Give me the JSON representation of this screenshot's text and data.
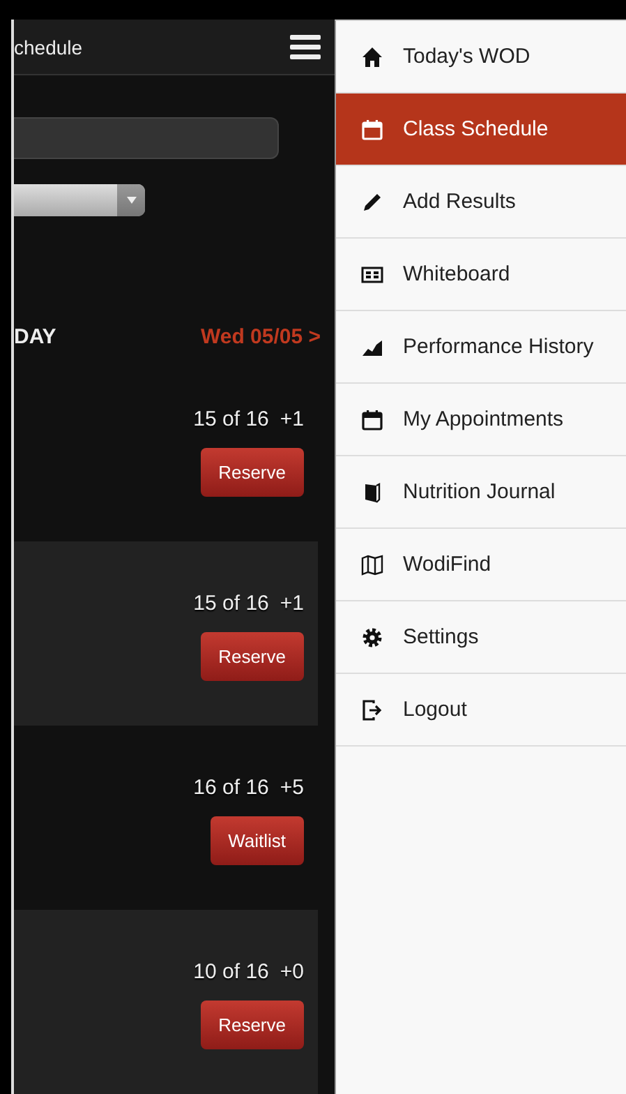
{
  "header": {
    "title": "chedule"
  },
  "day_header": {
    "label": "DAY",
    "next_date": "Wed 05/05 >"
  },
  "classes": [
    {
      "count": "15 of 16",
      "extra": "+1",
      "button": "Reserve"
    },
    {
      "count": "15 of 16",
      "extra": "+1",
      "button": "Reserve"
    },
    {
      "count": "16 of 16",
      "extra": "+5",
      "button": "Waitlist"
    },
    {
      "count": "10 of 16",
      "extra": "+0",
      "button": "Reserve"
    }
  ],
  "menu": [
    {
      "label": "Today's WOD",
      "selected": false
    },
    {
      "label": "Class Schedule",
      "selected": true
    },
    {
      "label": "Add Results",
      "selected": false
    },
    {
      "label": "Whiteboard",
      "selected": false
    },
    {
      "label": "Performance History",
      "selected": false
    },
    {
      "label": "My Appointments",
      "selected": false
    },
    {
      "label": "Nutrition Journal",
      "selected": false
    },
    {
      "label": "WodiFind",
      "selected": false
    },
    {
      "label": "Settings",
      "selected": false
    },
    {
      "label": "Logout",
      "selected": false
    }
  ]
}
